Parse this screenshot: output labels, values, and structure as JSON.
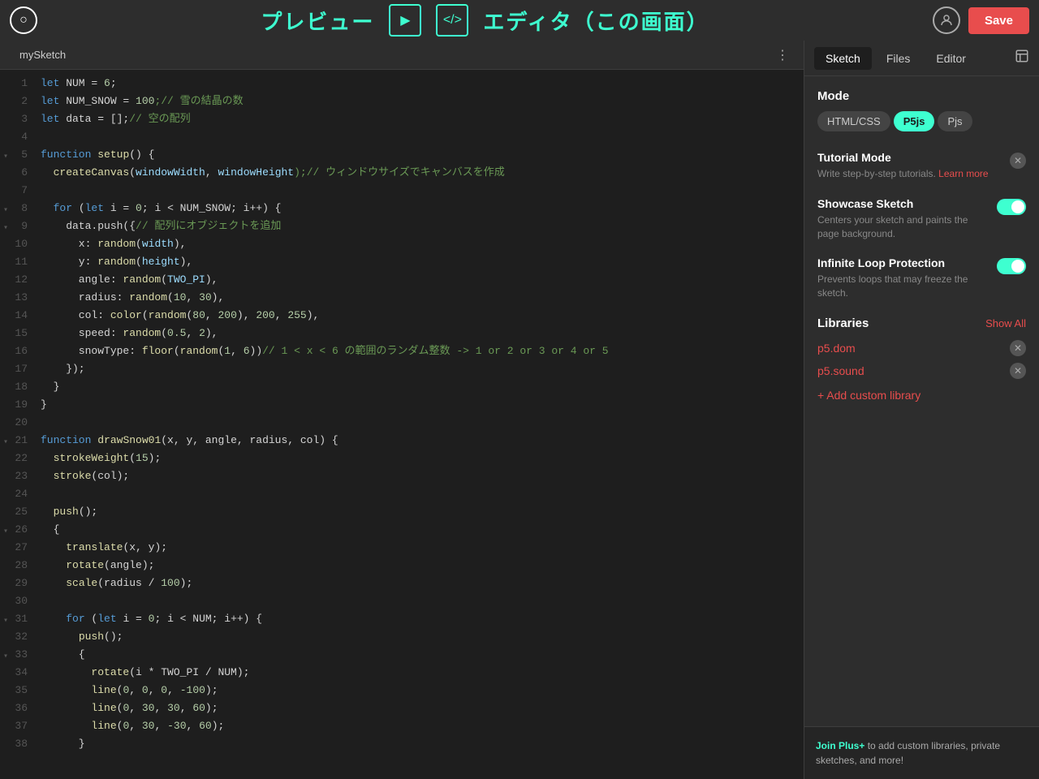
{
  "topbar": {
    "logo": "○",
    "title_left": "プレビュー",
    "title_right": "エディタ（この画面）",
    "play_icon": "▶",
    "code_icon": "</>",
    "save_label": "Save",
    "user_icon": "👤"
  },
  "code_tab": {
    "name": "mySketch",
    "dots": "⋮"
  },
  "code_lines": [
    {
      "num": "1",
      "content": "let NUM = 6;",
      "tokens": [
        {
          "t": "kw",
          "v": "let"
        },
        {
          "t": "",
          "v": " NUM = "
        },
        {
          "t": "num",
          "v": "6"
        },
        {
          "t": "",
          "v": ";"
        }
      ]
    },
    {
      "num": "2",
      "content": "let NUM_SNOW = 100;// 雪の結晶の数",
      "tokens": [
        {
          "t": "kw",
          "v": "let"
        },
        {
          "t": "",
          "v": " NUM_SNOW = "
        },
        {
          "t": "num",
          "v": "100"
        },
        {
          "t": "cmt",
          "v": ";// 雪の結晶の数"
        }
      ]
    },
    {
      "num": "3",
      "content": "let data = [];// 空の配列",
      "tokens": [
        {
          "t": "kw",
          "v": "let"
        },
        {
          "t": "",
          "v": " data = [];"
        },
        {
          "t": "cmt",
          "v": "// 空の配列"
        }
      ]
    },
    {
      "num": "4",
      "content": "",
      "tokens": []
    },
    {
      "num": "5",
      "content": "function setup() {",
      "fold": true,
      "tokens": [
        {
          "t": "kw",
          "v": "function"
        },
        {
          "t": "",
          "v": " "
        },
        {
          "t": "fn",
          "v": "setup"
        },
        {
          "t": "",
          "v": "() {"
        }
      ]
    },
    {
      "num": "6",
      "content": "  createCanvas(windowWidth, windowHeight);// ウィンドウサイズでキャンバスを作成",
      "tokens": [
        {
          "t": "",
          "v": "  "
        },
        {
          "t": "method",
          "v": "createCanvas"
        },
        {
          "t": "",
          "v": "("
        },
        {
          "t": "var",
          "v": "windowWidth"
        },
        {
          "t": "",
          "v": ", "
        },
        {
          "t": "var",
          "v": "windowHeight"
        },
        {
          "t": "cmt",
          "v": ");// ウィンドウサイズでキャンバスを作成"
        }
      ]
    },
    {
      "num": "7",
      "content": "",
      "tokens": []
    },
    {
      "num": "8",
      "content": "  for (let i = 0; i < NUM_SNOW; i++) {",
      "fold": true,
      "tokens": [
        {
          "t": "",
          "v": "  "
        },
        {
          "t": "kw",
          "v": "for"
        },
        {
          "t": "",
          "v": " ("
        },
        {
          "t": "kw",
          "v": "let"
        },
        {
          "t": "",
          "v": " i = "
        },
        {
          "t": "num",
          "v": "0"
        },
        {
          "t": "",
          "v": "; i < NUM_SNOW; i++) {"
        }
      ]
    },
    {
      "num": "9",
      "content": "    data.push({// 配列にオブジェクトを追加",
      "fold": true,
      "tokens": [
        {
          "t": "",
          "v": "    data.push({"
        },
        {
          "t": "cmt",
          "v": "// 配列にオブジェクトを追加"
        }
      ]
    },
    {
      "num": "10",
      "content": "      x: random(width),",
      "tokens": [
        {
          "t": "",
          "v": "      x: "
        },
        {
          "t": "fn",
          "v": "random"
        },
        {
          "t": "",
          "v": "("
        },
        {
          "t": "var",
          "v": "width"
        },
        {
          "t": "",
          "v": "),"
        }
      ]
    },
    {
      "num": "11",
      "content": "      y: random(height),",
      "tokens": [
        {
          "t": "",
          "v": "      y: "
        },
        {
          "t": "fn",
          "v": "random"
        },
        {
          "t": "",
          "v": "("
        },
        {
          "t": "var",
          "v": "height"
        },
        {
          "t": "",
          "v": "),"
        }
      ]
    },
    {
      "num": "12",
      "content": "      angle: random(TWO_PI),",
      "tokens": [
        {
          "t": "",
          "v": "      angle: "
        },
        {
          "t": "fn",
          "v": "random"
        },
        {
          "t": "",
          "v": "("
        },
        {
          "t": "var",
          "v": "TWO_PI"
        },
        {
          "t": "",
          "v": "),"
        }
      ]
    },
    {
      "num": "13",
      "content": "      radius: random(10, 30),",
      "tokens": [
        {
          "t": "",
          "v": "      radius: "
        },
        {
          "t": "fn",
          "v": "random"
        },
        {
          "t": "",
          "v": "("
        },
        {
          "t": "num",
          "v": "10"
        },
        {
          "t": "",
          "v": ", "
        },
        {
          "t": "num",
          "v": "30"
        },
        {
          "t": "",
          "v": "),"
        }
      ]
    },
    {
      "num": "14",
      "content": "      col: color(random(80, 200), 200, 255),",
      "tokens": [
        {
          "t": "",
          "v": "      col: "
        },
        {
          "t": "fn",
          "v": "color"
        },
        {
          "t": "",
          "v": "("
        },
        {
          "t": "fn",
          "v": "random"
        },
        {
          "t": "",
          "v": "("
        },
        {
          "t": "num",
          "v": "80"
        },
        {
          "t": "",
          "v": ", "
        },
        {
          "t": "num",
          "v": "200"
        },
        {
          "t": "",
          "v": "), "
        },
        {
          "t": "num",
          "v": "200"
        },
        {
          "t": "",
          "v": ", "
        },
        {
          "t": "num",
          "v": "255"
        },
        {
          "t": "",
          "v": "),"
        }
      ]
    },
    {
      "num": "15",
      "content": "      speed: random(0.5, 2),",
      "tokens": [
        {
          "t": "",
          "v": "      speed: "
        },
        {
          "t": "fn",
          "v": "random"
        },
        {
          "t": "",
          "v": "("
        },
        {
          "t": "num",
          "v": "0.5"
        },
        {
          "t": "",
          "v": ", "
        },
        {
          "t": "num",
          "v": "2"
        },
        {
          "t": "",
          "v": "),"
        }
      ]
    },
    {
      "num": "16",
      "content": "      snowType: floor(random(1, 6))// 1 < x < 6 の範囲のランダム整数 -> 1 or 2 or 3 or 4 or 5",
      "tokens": [
        {
          "t": "",
          "v": "      snowType: "
        },
        {
          "t": "fn",
          "v": "floor"
        },
        {
          "t": "",
          "v": "("
        },
        {
          "t": "fn",
          "v": "random"
        },
        {
          "t": "",
          "v": "("
        },
        {
          "t": "num",
          "v": "1"
        },
        {
          "t": "",
          "v": ", "
        },
        {
          "t": "num",
          "v": "6"
        },
        {
          "t": "",
          "v": "))"
        },
        {
          "t": "cmt",
          "v": "// 1 < x < 6 の範囲のランダム整数 -> 1 or 2 or 3 or 4 or 5"
        }
      ]
    },
    {
      "num": "17",
      "content": "    });",
      "tokens": [
        {
          "t": "",
          "v": "    });"
        }
      ]
    },
    {
      "num": "18",
      "content": "  }",
      "tokens": [
        {
          "t": "",
          "v": "  }"
        }
      ]
    },
    {
      "num": "19",
      "content": "}",
      "tokens": [
        {
          "t": "",
          "v": "}"
        }
      ]
    },
    {
      "num": "20",
      "content": "",
      "tokens": []
    },
    {
      "num": "21",
      "content": "function drawSnow01(x, y, angle, radius, col) {",
      "fold": true,
      "tokens": [
        {
          "t": "kw",
          "v": "function"
        },
        {
          "t": "",
          "v": " "
        },
        {
          "t": "fn",
          "v": "drawSnow01"
        },
        {
          "t": "",
          "v": "(x, y, angle, radius, col) {"
        }
      ]
    },
    {
      "num": "22",
      "content": "  strokeWeight(15);",
      "tokens": [
        {
          "t": "",
          "v": "  "
        },
        {
          "t": "fn",
          "v": "strokeWeight"
        },
        {
          "t": "",
          "v": "("
        },
        {
          "t": "num",
          "v": "15"
        },
        {
          "t": "",
          "v": ");"
        }
      ]
    },
    {
      "num": "23",
      "content": "  stroke(col);",
      "tokens": [
        {
          "t": "",
          "v": "  "
        },
        {
          "t": "fn",
          "v": "stroke"
        },
        {
          "t": "",
          "v": "(col);"
        }
      ]
    },
    {
      "num": "24",
      "content": "",
      "tokens": []
    },
    {
      "num": "25",
      "content": "  push();",
      "tokens": [
        {
          "t": "",
          "v": "  "
        },
        {
          "t": "fn",
          "v": "push"
        },
        {
          "t": "",
          "v": "();"
        }
      ]
    },
    {
      "num": "26",
      "content": "  {",
      "fold": true,
      "tokens": [
        {
          "t": "",
          "v": "  {"
        }
      ]
    },
    {
      "num": "27",
      "content": "    translate(x, y);",
      "tokens": [
        {
          "t": "",
          "v": "    "
        },
        {
          "t": "fn",
          "v": "translate"
        },
        {
          "t": "",
          "v": "(x, y);"
        }
      ]
    },
    {
      "num": "28",
      "content": "    rotate(angle);",
      "tokens": [
        {
          "t": "",
          "v": "    "
        },
        {
          "t": "fn",
          "v": "rotate"
        },
        {
          "t": "",
          "v": "(angle);"
        }
      ]
    },
    {
      "num": "29",
      "content": "    scale(radius / 100);",
      "tokens": [
        {
          "t": "",
          "v": "    "
        },
        {
          "t": "fn",
          "v": "scale"
        },
        {
          "t": "",
          "v": "(radius / "
        },
        {
          "t": "num",
          "v": "100"
        },
        {
          "t": "",
          "v": ");"
        }
      ]
    },
    {
      "num": "30",
      "content": "",
      "tokens": []
    },
    {
      "num": "31",
      "content": "    for (let i = 0; i < NUM; i++) {",
      "fold": true,
      "tokens": [
        {
          "t": "",
          "v": "    "
        },
        {
          "t": "kw",
          "v": "for"
        },
        {
          "t": "",
          "v": " ("
        },
        {
          "t": "kw",
          "v": "let"
        },
        {
          "t": "",
          "v": " i = "
        },
        {
          "t": "num",
          "v": "0"
        },
        {
          "t": "",
          "v": "; i < NUM; i++) {"
        }
      ]
    },
    {
      "num": "32",
      "content": "      push();",
      "tokens": [
        {
          "t": "",
          "v": "      "
        },
        {
          "t": "fn",
          "v": "push"
        },
        {
          "t": "",
          "v": "();"
        }
      ]
    },
    {
      "num": "33",
      "content": "      {",
      "fold": true,
      "tokens": [
        {
          "t": "",
          "v": "      {"
        }
      ]
    },
    {
      "num": "34",
      "content": "        rotate(i * TWO_PI / NUM);",
      "tokens": [
        {
          "t": "",
          "v": "        "
        },
        {
          "t": "fn",
          "v": "rotate"
        },
        {
          "t": "",
          "v": "(i * TWO_PI / NUM);"
        }
      ]
    },
    {
      "num": "35",
      "content": "        line(0, 0, 0, -100);",
      "tokens": [
        {
          "t": "",
          "v": "        "
        },
        {
          "t": "fn",
          "v": "line"
        },
        {
          "t": "",
          "v": "("
        },
        {
          "t": "num",
          "v": "0"
        },
        {
          "t": "",
          "v": ", "
        },
        {
          "t": "num",
          "v": "0"
        },
        {
          "t": "",
          "v": ", "
        },
        {
          "t": "num",
          "v": "0"
        },
        {
          "t": "",
          "v": ", "
        },
        {
          "t": "num",
          "v": "-100"
        },
        {
          "t": "",
          "v": ");"
        }
      ]
    },
    {
      "num": "36",
      "content": "        line(0, 30, 30, 60);",
      "tokens": [
        {
          "t": "",
          "v": "        "
        },
        {
          "t": "fn",
          "v": "line"
        },
        {
          "t": "",
          "v": "("
        },
        {
          "t": "num",
          "v": "0"
        },
        {
          "t": "",
          "v": ", "
        },
        {
          "t": "num",
          "v": "30"
        },
        {
          "t": "",
          "v": ", "
        },
        {
          "t": "num",
          "v": "30"
        },
        {
          "t": "",
          "v": ", "
        },
        {
          "t": "num",
          "v": "60"
        },
        {
          "t": "",
          "v": ");"
        }
      ]
    },
    {
      "num": "37",
      "content": "        line(0, 30, -30, 60);",
      "tokens": [
        {
          "t": "",
          "v": "        "
        },
        {
          "t": "fn",
          "v": "line"
        },
        {
          "t": "",
          "v": "("
        },
        {
          "t": "num",
          "v": "0"
        },
        {
          "t": "",
          "v": ", "
        },
        {
          "t": "num",
          "v": "30"
        },
        {
          "t": "",
          "v": ", "
        },
        {
          "t": "num",
          "v": "-30"
        },
        {
          "t": "",
          "v": ", "
        },
        {
          "t": "num",
          "v": "60"
        },
        {
          "t": "",
          "v": ");"
        }
      ]
    },
    {
      "num": "38",
      "content": "      }",
      "tokens": [
        {
          "t": "",
          "v": "      }"
        }
      ]
    }
  ],
  "right_panel": {
    "tabs": [
      "Sketch",
      "Files",
      "Editor"
    ],
    "active_tab": "Sketch",
    "layout_icon": "⬜",
    "mode": {
      "label": "Mode",
      "options": [
        "HTML/CSS",
        "P5js",
        "Pjs"
      ],
      "active": "P5js"
    },
    "tutorial_mode": {
      "title": "Tutorial Mode",
      "desc": "Write step-by-step tutorials.",
      "link_text": "Learn more",
      "enabled": false
    },
    "showcase_sketch": {
      "title": "Showcase Sketch",
      "desc": "Centers your sketch and paints the page background.",
      "enabled": true
    },
    "infinite_loop": {
      "title": "Infinite Loop Protection",
      "desc": "Prevents loops that may freeze the sketch.",
      "enabled": true
    },
    "libraries": {
      "title": "Libraries",
      "show_all_label": "Show All",
      "items": [
        "p5.dom",
        "p5.sound"
      ],
      "add_label": "+ Add custom library"
    },
    "bottom": {
      "join_link": "Join Plus+",
      "join_text": " to add custom libraries, private sketches, and more!"
    }
  }
}
